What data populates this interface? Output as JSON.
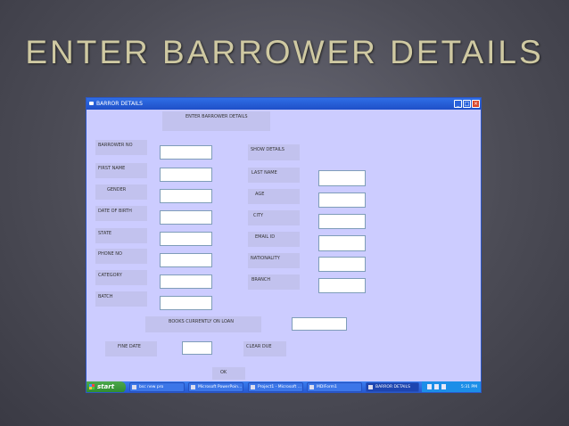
{
  "slide_title": "ENTER BARROWER DETAILS",
  "window": {
    "title": "BARROR DETAILS",
    "minimize_glyph": "_",
    "maximize_glyph": "□",
    "close_glyph": "×"
  },
  "form": {
    "heading": "ENTER BARROWER DETAILS",
    "barrower_no": "BARROWER NO",
    "first_name": "FIRST NAME",
    "gender": "GENDER",
    "date_of_birth": "DATE OF BIRTH",
    "state": "STATE",
    "phone_no": "PHONE NO",
    "category": "CATEGORY",
    "batch": "BATCH",
    "show_details": "SHOW DETAILS",
    "last_name": "LAST NAME",
    "age": "AGE",
    "city": "CITY",
    "email_id": "EMAIL ID",
    "nationality": "NATIONALITY",
    "branch": "BRANCH",
    "books_on_loan": "BOOKS CURRENTLY ON LOAN",
    "fine_date": "FINE DATE",
    "clear_due": "CLEAR DUE",
    "ok": "OK"
  },
  "taskbar": {
    "start": "start",
    "items": [
      "bsc new pro",
      "Microsoft PowerPoin...",
      "Project1 - Microsoft ...",
      "MDIForm1",
      "BARROR DETAILS"
    ],
    "clock": "5:31 PM"
  }
}
